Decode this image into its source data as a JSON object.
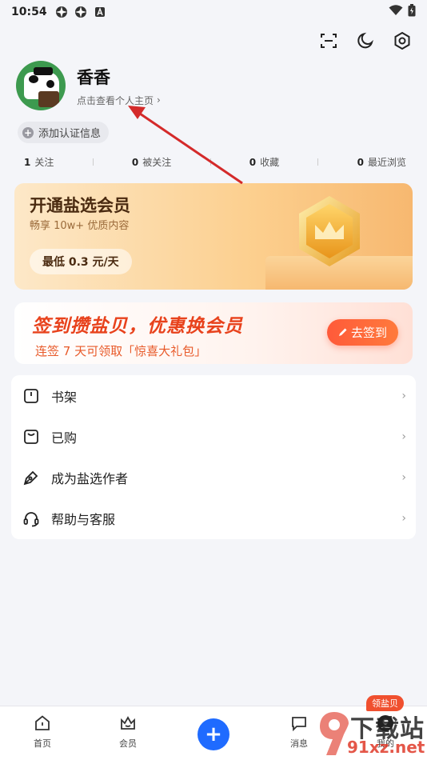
{
  "status_bar": {
    "time": "10:54"
  },
  "profile": {
    "name": "香香",
    "link_text": "点击查看个人主页",
    "link_chevron": "›",
    "cert_button": "添加认证信息"
  },
  "stats": [
    {
      "count": "1",
      "label": "关注"
    },
    {
      "count": "0",
      "label": "被关注"
    },
    {
      "count": "0",
      "label": "收藏"
    },
    {
      "count": "0",
      "label": "最近浏览"
    }
  ],
  "vip_card": {
    "title": "开通盐选会员",
    "subtitle": "畅享 10w+ 优质内容",
    "price": "最低 0.3 元/天"
  },
  "sign_card": {
    "title": "签到攒盐贝，优惠换会员",
    "subtitle": "连签 7 天可领取「惊喜大礼包」",
    "button": "去签到"
  },
  "menu": [
    {
      "label": "书架",
      "icon": "bookshelf-icon"
    },
    {
      "label": "已购",
      "icon": "purchased-icon"
    },
    {
      "label": "成为盐选作者",
      "icon": "pen-icon"
    },
    {
      "label": "帮助与客服",
      "icon": "headset-icon"
    }
  ],
  "menu_chevron": "›",
  "tabs": [
    {
      "label": "首页",
      "icon": "home-icon"
    },
    {
      "label": "会员",
      "icon": "member-icon"
    },
    {
      "label": "消息",
      "icon": "message-icon"
    },
    {
      "label": "我的",
      "icon": "profile-icon"
    }
  ],
  "fab_label": "+",
  "tab_badge": "领盐贝",
  "watermark": {
    "line1": "下载站",
    "line2": "91xz.net"
  },
  "colors": {
    "accent_blue": "#1f6bff",
    "sign_red": "#e8421c",
    "badge_red": "#f0502f",
    "annotation_arrow": "#d42a2a"
  }
}
